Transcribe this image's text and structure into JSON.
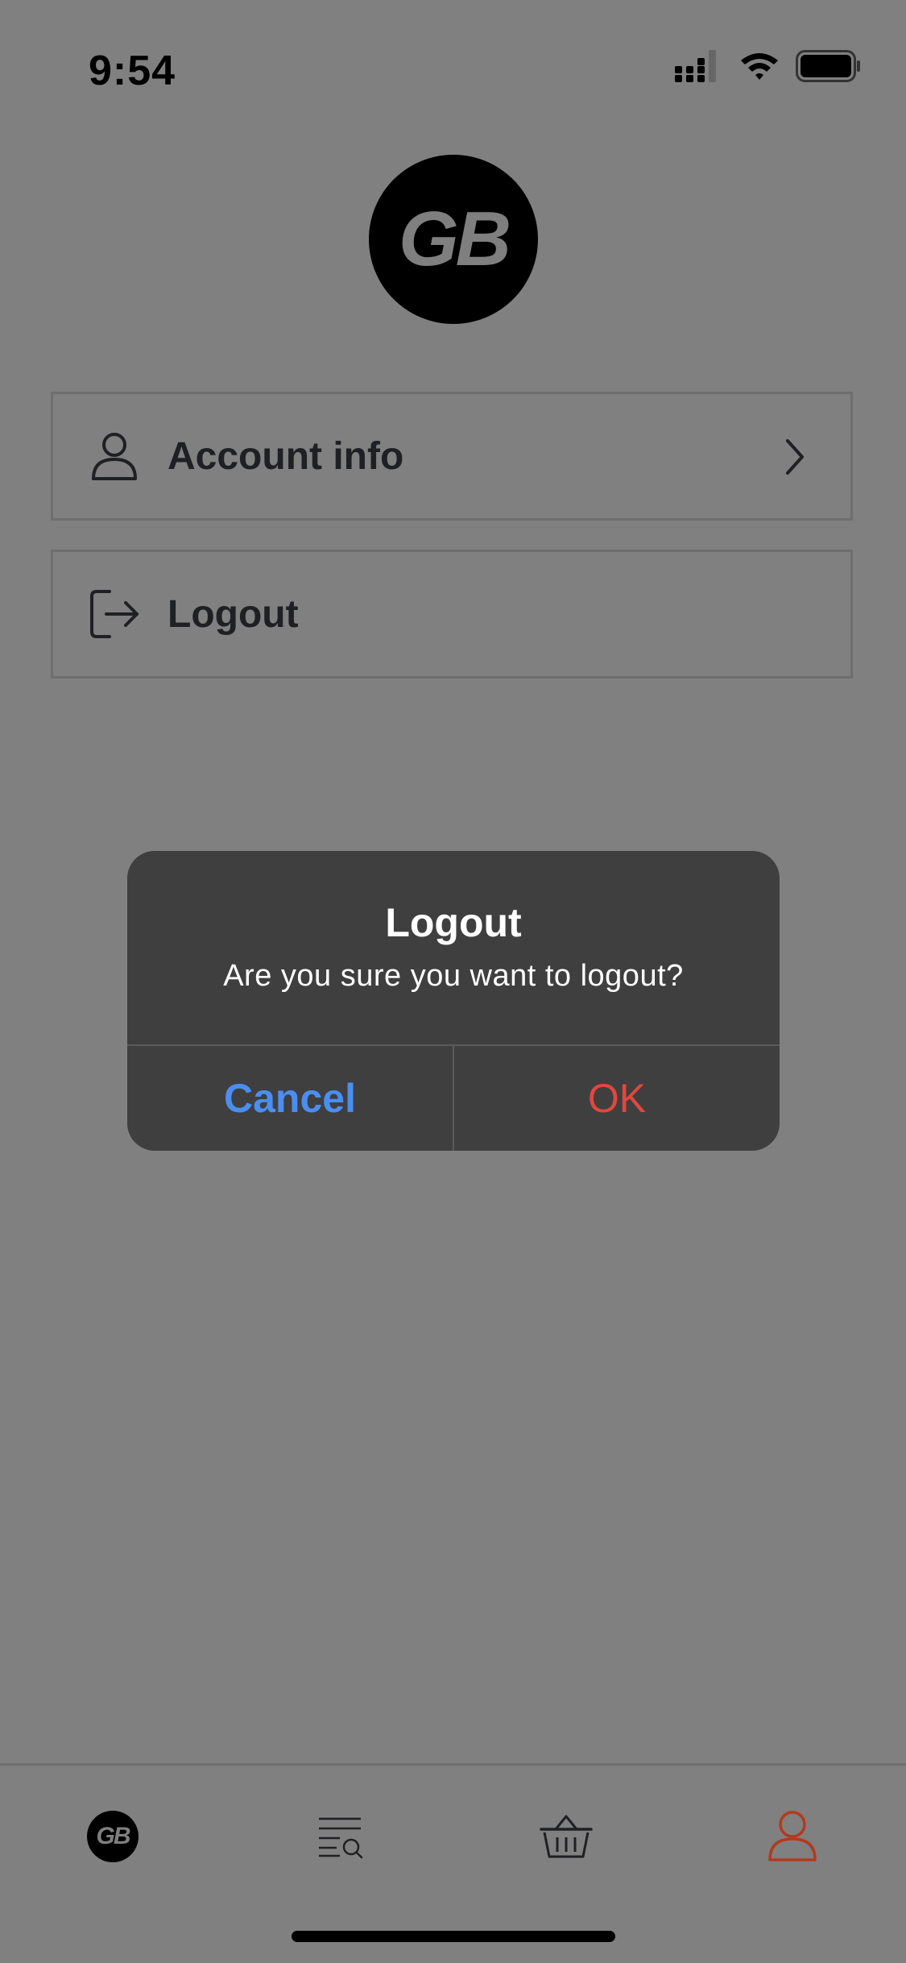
{
  "status_bar": {
    "time": "9:54"
  },
  "logo": {
    "text": "GB"
  },
  "menu": {
    "account_info_label": "Account info",
    "logout_label": "Logout"
  },
  "dialog": {
    "title": "Logout",
    "message": "Are you sure you want to logout?",
    "cancel_label": "Cancel",
    "ok_label": "OK"
  },
  "tabbar": {
    "home_logo_text": "GB",
    "active_tab": "account"
  },
  "colors": {
    "background_dim": "#808080",
    "dialog_bg": "#3f3f3f",
    "cancel": "#4b8ef0",
    "ok": "#e2473d",
    "active_tab": "#b23a1e"
  },
  "icons": [
    "signal-icon",
    "wifi-icon",
    "battery-icon",
    "person-icon",
    "chevron-right-icon",
    "logout-icon",
    "catalog-search-icon",
    "basket-icon",
    "account-icon"
  ]
}
